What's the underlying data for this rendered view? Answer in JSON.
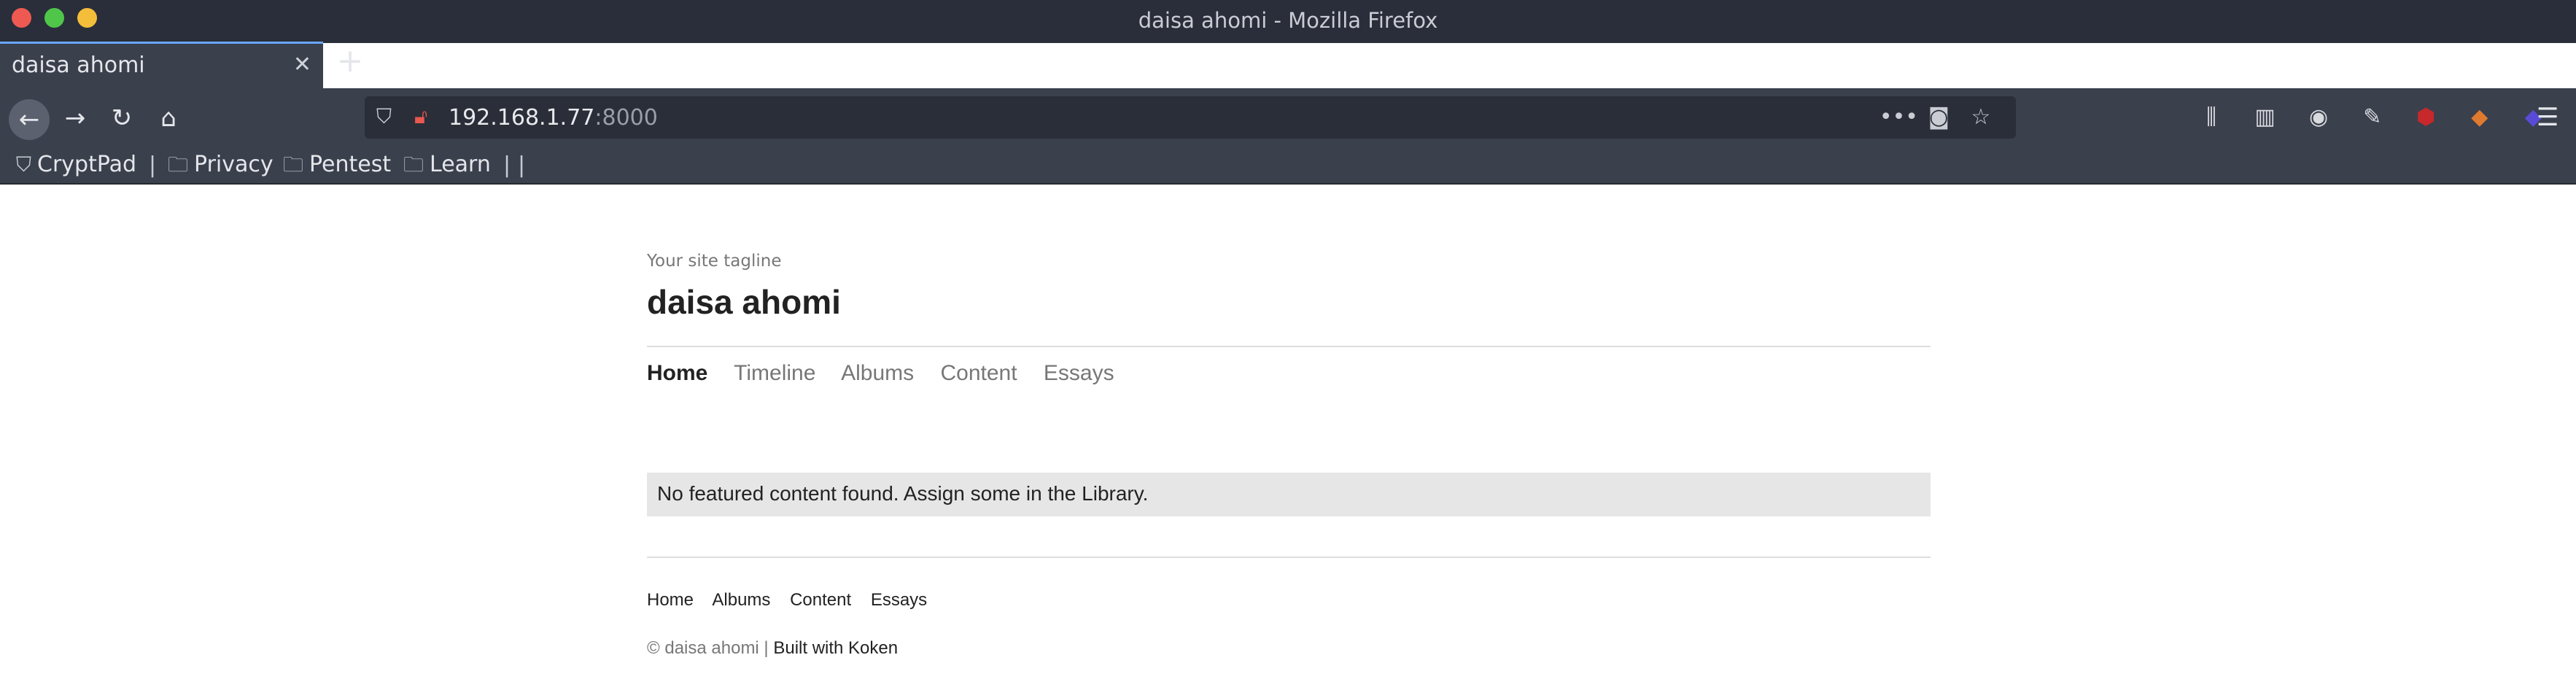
{
  "window": {
    "title": "daisa ahomi - Mozilla Firefox"
  },
  "tabs": [
    {
      "label": "daisa ahomi",
      "close": "✕"
    }
  ],
  "toolbar": {
    "new_tab": "+",
    "back": "←",
    "forward": "→",
    "reload": "↻",
    "home": "⌂"
  },
  "urlbar": {
    "host": "192.168.1.77",
    "port": ":8000",
    "more": "•••",
    "pocket": "◙",
    "bookmark_star": "☆"
  },
  "bookmarks": [
    {
      "label": "CryptPad",
      "icon": "cryptpad-icon"
    },
    {
      "label": "Privacy",
      "icon": "folder-icon"
    },
    {
      "label": "Pentest",
      "icon": "folder-icon"
    },
    {
      "label": "Learn",
      "icon": "folder-icon"
    }
  ],
  "site": {
    "tagline": "Your site tagline",
    "title": "daisa ahomi",
    "nav": [
      "Home",
      "Timeline",
      "Albums",
      "Content",
      "Essays"
    ],
    "active_nav": "Home",
    "notice": "No featured content found. Assign some in the Library.",
    "footer_nav": [
      "Home",
      "Albums",
      "Content",
      "Essays"
    ],
    "copyright": "© daisa ahomi | ",
    "built_with": "Built with Koken"
  },
  "colors": {
    "chrome": "#2a2e3a",
    "toolbar": "#3b404d",
    "accent": "#6aa8ff",
    "notice_bg": "#e6e6e6"
  }
}
